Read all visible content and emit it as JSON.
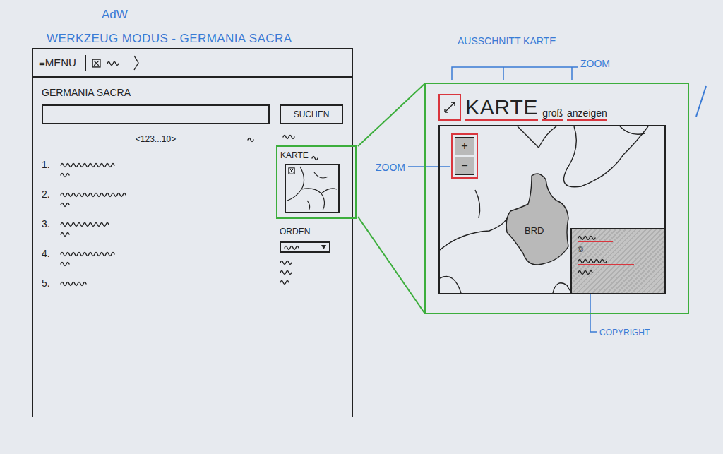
{
  "sheet": {
    "org": "AdW",
    "title": "WERKZEUG MODUS - GERMANIA SACRA",
    "detail_title": "AUSSCHNITT KARTE"
  },
  "wireframe": {
    "menu_icon": "≡",
    "menu": "MENU",
    "page_title": "GERMANIA SACRA",
    "search_button": "SUCHEN",
    "pagination": "<123...10>",
    "results": [
      {
        "number": "1.",
        "lines": 2
      },
      {
        "number": "2.",
        "lines": 2
      },
      {
        "number": "3.",
        "lines": 2
      },
      {
        "number": "4.",
        "lines": 2
      },
      {
        "number": "5.",
        "lines": 1
      }
    ],
    "map_label": "KARTE",
    "order_label": "ORDEN"
  },
  "map_detail": {
    "title": "KARTE",
    "size_word": "groß",
    "action": "anzeigen",
    "zoom_in": "+",
    "zoom_out": "−",
    "region": "BRD",
    "copyright_mark": "©"
  },
  "annotations": {
    "zoom_header": "ZOOM",
    "zoom_control": "ZOOM",
    "copyright": "COPYRIGHT"
  }
}
